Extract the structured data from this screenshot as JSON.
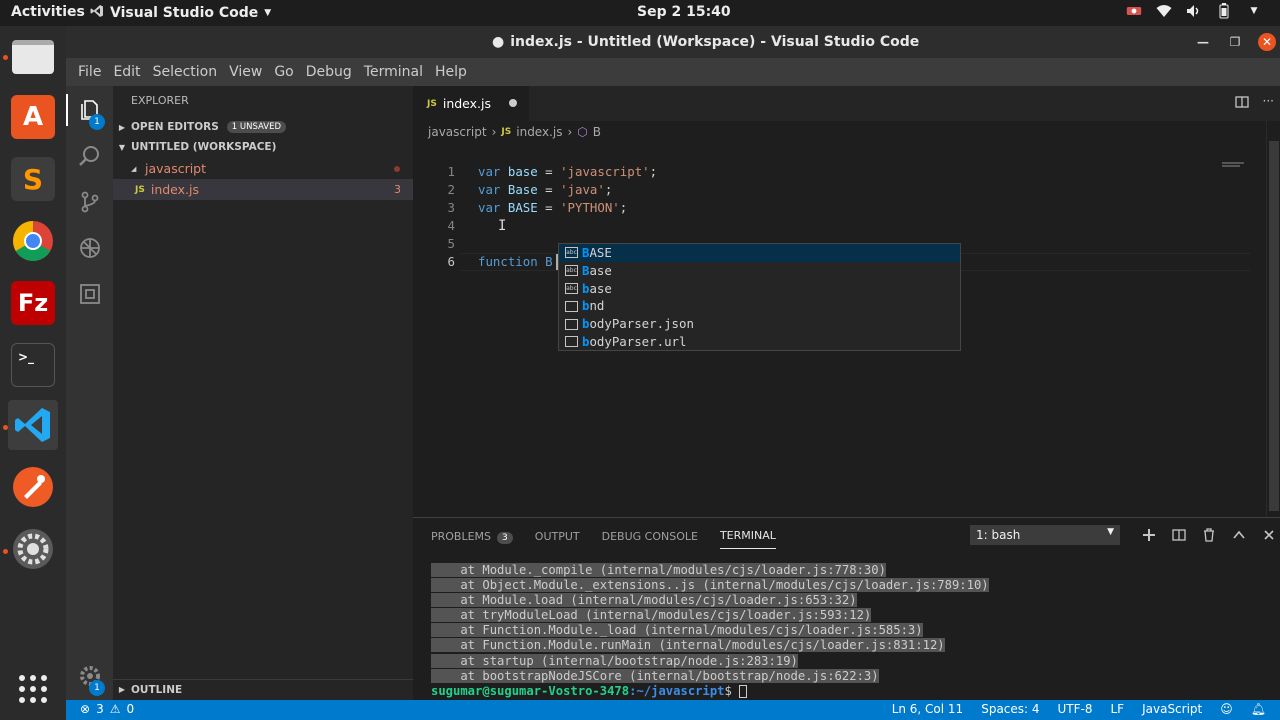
{
  "colors": {
    "accent": "#007acc",
    "ubuntu_orange": "#e95420",
    "keyword": "#569cd6",
    "string": "#ce9178",
    "variable": "#9cdcfe"
  },
  "topbar": {
    "activities": "Activities",
    "app_name": "Visual Studio Code",
    "clock": "Sep 2  15:40"
  },
  "window": {
    "title": "index.js - Untitled (Workspace) - Visual Studio Code",
    "dirty_marker": "●"
  },
  "menu": [
    "File",
    "Edit",
    "Selection",
    "View",
    "Go",
    "Debug",
    "Terminal",
    "Help"
  ],
  "activity": {
    "explorer_badge": "1",
    "settings_badge": "1"
  },
  "sidebar": {
    "title": "EXPLORER",
    "open_editors": "OPEN EDITORS",
    "unsaved": "1 UNSAVED",
    "workspace": "UNTITLED (WORKSPACE)",
    "folder": "javascript",
    "file": "index.js",
    "file_tag": "JS",
    "file_problems": "3",
    "outline": "OUTLINE"
  },
  "editor": {
    "tab_label": "index.js",
    "tab_tag": "JS",
    "breadcrumbs": [
      "javascript",
      "index.js",
      "B"
    ],
    "lines": [
      {
        "n": "1",
        "kw": "var",
        "name": "base",
        "op": " = ",
        "str": "'javascript'",
        "end": ";"
      },
      {
        "n": "2",
        "kw": "var",
        "name": "Base",
        "op": " = ",
        "str": "'java'",
        "end": ";"
      },
      {
        "n": "3",
        "kw": "var",
        "name": "BASE",
        "op": " = ",
        "str": "'PYTHON'",
        "end": ";"
      },
      {
        "n": "4"
      },
      {
        "n": "5"
      },
      {
        "n": "6",
        "text": "function B"
      }
    ]
  },
  "suggest": {
    "items": [
      {
        "hl": "B",
        "rest": "ASE",
        "icon": "abc"
      },
      {
        "hl": "B",
        "rest": "ase",
        "icon": "abc"
      },
      {
        "hl": "b",
        "rest": "ase",
        "icon": "abc"
      },
      {
        "hl": "b",
        "rest": "nd",
        "icon": ""
      },
      {
        "hl": "b",
        "rest": "odyParser.json",
        "icon": ""
      },
      {
        "hl": "b",
        "rest": "odyParser.url",
        "icon": ""
      }
    ]
  },
  "panel": {
    "tabs": [
      "PROBLEMS",
      "OUTPUT",
      "DEBUG CONSOLE",
      "TERMINAL"
    ],
    "problems_count": "3",
    "terminal_select": "1: bash",
    "lines": [
      "    at Module._compile (internal/modules/cjs/loader.js:778:30)",
      "    at Object.Module._extensions..js (internal/modules/cjs/loader.js:789:10)",
      "    at Module.load (internal/modules/cjs/loader.js:653:32)",
      "    at tryModuleLoad (internal/modules/cjs/loader.js:593:12)",
      "    at Function.Module._load (internal/modules/cjs/loader.js:585:3)",
      "    at Function.Module.runMain (internal/modules/cjs/loader.js:831:12)",
      "    at startup (internal/bootstrap/node.js:283:19)",
      "    at bootstrapNodeJSCore (internal/bootstrap/node.js:622:3)"
    ],
    "prompt_user": "sugumar@sugumar-Vostro-3478",
    "prompt_path": ":~/javascript",
    "prompt_end": "$ "
  },
  "status": {
    "errors": "3",
    "warnings": "0",
    "position": "Ln 6, Col 11",
    "spaces": "Spaces: 4",
    "encoding": "UTF-8",
    "eol": "LF",
    "language": "JavaScript"
  }
}
